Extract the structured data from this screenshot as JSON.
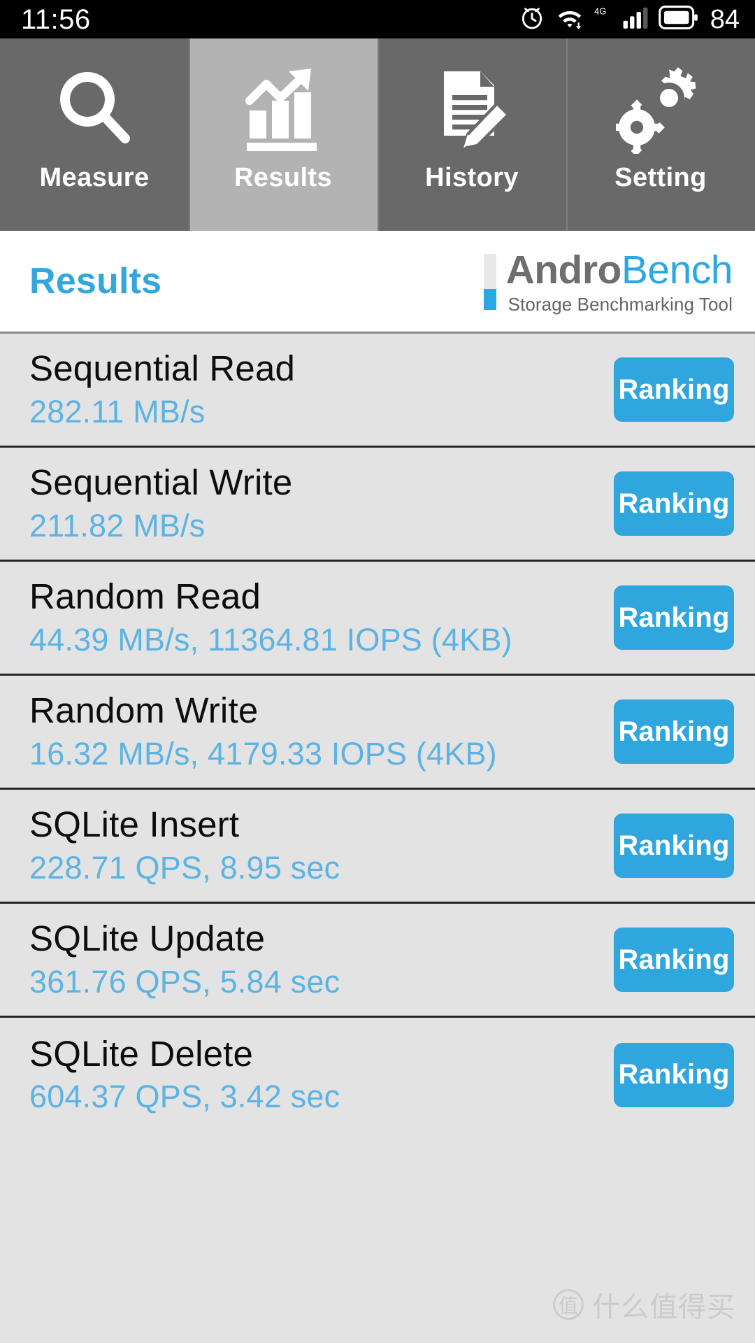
{
  "statusbar": {
    "clock": "11:56",
    "battery_level": "84",
    "icons": [
      "alarm-icon",
      "wifi-icon",
      "network-4g-icon",
      "signal-bars-icon",
      "battery-icon"
    ]
  },
  "tabs": [
    {
      "label": "Measure",
      "icon": "magnifier-icon",
      "active": false
    },
    {
      "label": "Results",
      "icon": "bar-chart-growth-icon",
      "active": true
    },
    {
      "label": "History",
      "icon": "document-pencil-icon",
      "active": false
    },
    {
      "label": "Setting",
      "icon": "gears-icon",
      "active": false
    }
  ],
  "header": {
    "title": "Results",
    "logo_primary": "Andro",
    "logo_secondary": "Bench",
    "logo_tagline": "Storage Benchmarking Tool"
  },
  "results": [
    {
      "name": "Sequential Read",
      "value": "282.11 MB/s",
      "button": "Ranking"
    },
    {
      "name": "Sequential Write",
      "value": "211.82 MB/s",
      "button": "Ranking"
    },
    {
      "name": "Random Read",
      "value": "44.39 MB/s, 11364.81 IOPS (4KB)",
      "button": "Ranking"
    },
    {
      "name": "Random Write",
      "value": "16.32 MB/s, 4179.33 IOPS (4KB)",
      "button": "Ranking"
    },
    {
      "name": "SQLite Insert",
      "value": "228.71 QPS, 8.95 sec",
      "button": "Ranking"
    },
    {
      "name": "SQLite Update",
      "value": "361.76 QPS, 5.84 sec",
      "button": "Ranking"
    },
    {
      "name": "SQLite Delete",
      "value": "604.37 QPS, 3.42 sec",
      "button": "Ranking"
    }
  ],
  "watermark": {
    "badge": "值",
    "text": "什么值得买"
  },
  "colors": {
    "accent_blue": "#2fa7de",
    "value_blue": "#5cb3e4",
    "tab_inactive": "#696969",
    "tab_active": "#b3b3b3",
    "list_bg": "#e3e3e3"
  }
}
